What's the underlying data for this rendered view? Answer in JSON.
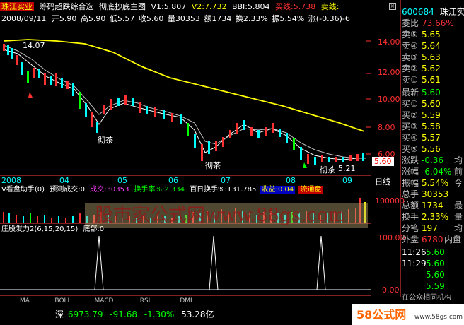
{
  "header": {
    "stock": "珠江实业",
    "indicator": "筹码超跌综合选",
    "subtitle": "彻底抄底主图",
    "v1": "V1:5.807",
    "v2": "V2:7.732",
    "bbi": "BBI:5.804",
    "buy_line": "买线:5.738",
    "sell_line": "卖线:",
    "date": "2008/09/11",
    "open": "开5.90",
    "high": "高5.90",
    "low": "低5.57",
    "close": "收5.60",
    "vol": "量30353",
    "amount": "额1734",
    "turnover": "换2.33%",
    "amplitude": "振5.54%",
    "change": "涨(-0.36)-6"
  },
  "main_chart": {
    "price_ticks": [
      "14.00",
      "12.00",
      "10.00",
      "8.00",
      "6.00"
    ],
    "high_label": "14.07",
    "current_price": "5.60",
    "annotations": [
      "彻茶",
      "彻茶",
      "彻茶",
      "5.21"
    ],
    "x_labels": [
      "2008",
      "04",
      "05",
      "06",
      "07",
      "08",
      "09"
    ],
    "period": "日线"
  },
  "volume_panel": {
    "title": "V看盘助手(0)",
    "forecast": "预测成交:0",
    "deal": "成交:30353",
    "turnover_rate": "换手率%:2.334",
    "hundred_day": "百日换手%:131.785",
    "profit": "收益:0.04",
    "flow": "流通盘",
    "tick": "100000"
  },
  "watermark": "股市家公式网www.88gs.com",
  "osc_panel": {
    "title": "庄股发力2(6,15,20,15)",
    "bottom": "底部:0",
    "ticks": [
      "100.00",
      "0.00"
    ]
  },
  "tabs": [
    "MA",
    "BOLL",
    "MACD",
    "RSI",
    "DMI"
  ],
  "status_bar": {
    "index": "深",
    "value": "6973.79",
    "change": "-91.68",
    "pct": "-1.30%",
    "amount": "53.28亿"
  },
  "quote": {
    "code": "600684",
    "name": "珠江实业",
    "weibi_label": "委比",
    "weibi": "73.66%",
    "sells": [
      {
        "label": "卖⑤",
        "price": "5.65"
      },
      {
        "label": "卖④",
        "price": "5.64"
      },
      {
        "label": "卖③",
        "price": "5.63"
      },
      {
        "label": "卖②",
        "price": "5.62"
      },
      {
        "label": "卖①",
        "price": "5.61"
      }
    ],
    "latest_label": "最新",
    "latest": "5.60",
    "buys": [
      {
        "label": "买①",
        "price": "5.60"
      },
      {
        "label": "买②",
        "price": "5.59"
      },
      {
        "label": "买③",
        "price": "5.58"
      },
      {
        "label": "买④",
        "price": "5.57"
      },
      {
        "label": "买⑤",
        "price": "5.56"
      }
    ],
    "stats": [
      {
        "label": "涨跌",
        "value": "-0.36",
        "extra": "均"
      },
      {
        "label": "涨幅",
        "value": "-6.04%",
        "extra": "前"
      },
      {
        "label": "振幅",
        "value": "5.54%",
        "extra": "今"
      },
      {
        "label": "总手",
        "value": "30353",
        "extra": ""
      },
      {
        "label": "总额",
        "value": "1734",
        "extra": "最"
      },
      {
        "label": "换手",
        "value": "2.33%",
        "extra": "量"
      },
      {
        "label": "分笔",
        "value": "197",
        "extra": "均"
      }
    ],
    "outer_label": "外盘",
    "outer": "6780",
    "inner_label": "内盘",
    "ticks": [
      {
        "time": "11:26",
        "price": "5.60"
      },
      {
        "time": "11:29",
        "price": "5.60"
      },
      {
        "time": "",
        "price": "5.60"
      },
      {
        "time": "",
        "price": "5.59"
      }
    ],
    "footer": "在公众相同机构"
  },
  "brand": "58公式网",
  "brand_url": "www.58gs.com"
}
